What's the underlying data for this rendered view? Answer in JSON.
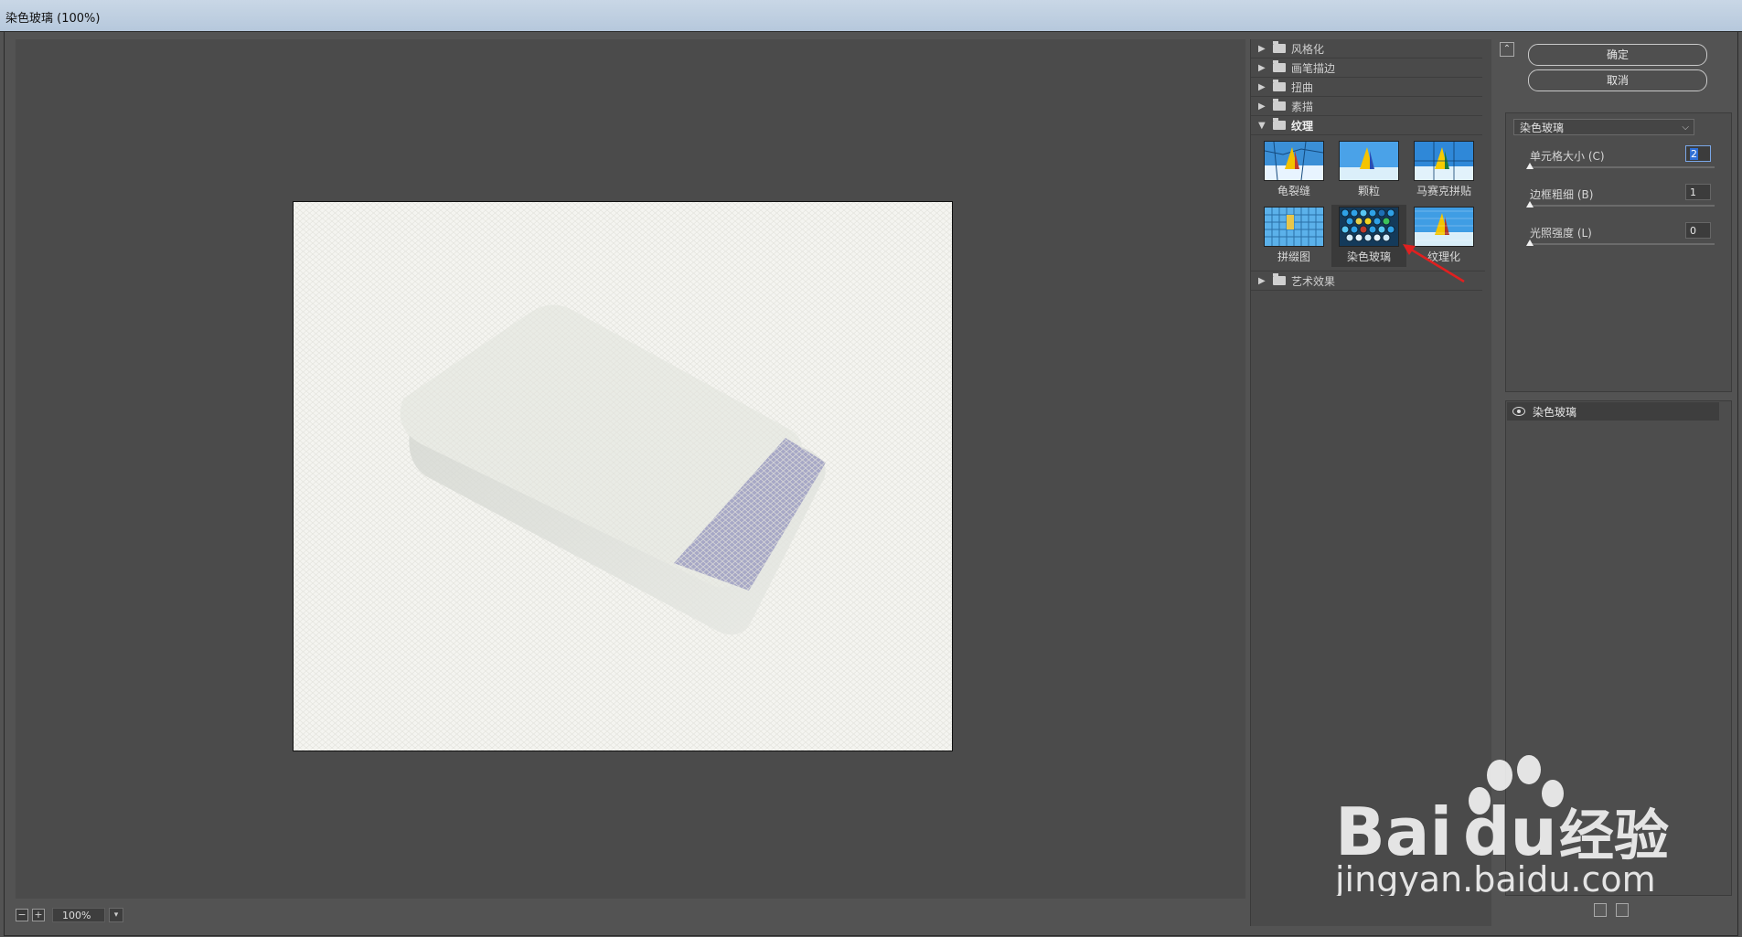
{
  "window": {
    "title": "染色玻璃 (100%)"
  },
  "canvas": {
    "zoom": "100%",
    "zoom_out_symbol": "−",
    "zoom_in_symbol": "+"
  },
  "gallery": {
    "folders_before": [
      {
        "label": "风格化",
        "icon": "folder-icon",
        "expanded": false
      },
      {
        "label": "画笔描边",
        "icon": "folder-icon",
        "expanded": false
      },
      {
        "label": "扭曲",
        "icon": "folder-icon",
        "expanded": false
      },
      {
        "label": "素描",
        "icon": "folder-icon",
        "expanded": false
      }
    ],
    "open_folder": {
      "label": "纹理",
      "icon": "folder-open-icon",
      "expanded": true
    },
    "thumbnails": [
      {
        "label": "龟裂缝"
      },
      {
        "label": "颗粒"
      },
      {
        "label": "马赛克拼贴"
      },
      {
        "label": "拼缀图"
      },
      {
        "label": "染色玻璃",
        "selected": true
      },
      {
        "label": "纹理化"
      }
    ],
    "folders_after": [
      {
        "label": "艺术效果",
        "icon": "folder-icon",
        "expanded": false
      }
    ]
  },
  "actions": {
    "ok_label": "确定",
    "cancel_label": "取消"
  },
  "filter": {
    "selected": "染色玻璃",
    "params": [
      {
        "label": "单元格大小 (C)",
        "value": "2",
        "fraction": 0.0
      },
      {
        "label": "边框粗细 (B)",
        "value": "1",
        "fraction": 0.0
      },
      {
        "label": "光照强度 (L)",
        "value": "0",
        "fraction": 0.0
      }
    ]
  },
  "layers": [
    {
      "name": "染色玻璃",
      "visible": true
    }
  ],
  "watermark": {
    "brand": "Bai",
    "brand2": "du",
    "cn": "经验",
    "url": "jingyan.baidu.com"
  },
  "colors": {
    "panel": "#535353",
    "annotation_arrow": "#e02020",
    "tab_purple": "#a7a8c6"
  }
}
